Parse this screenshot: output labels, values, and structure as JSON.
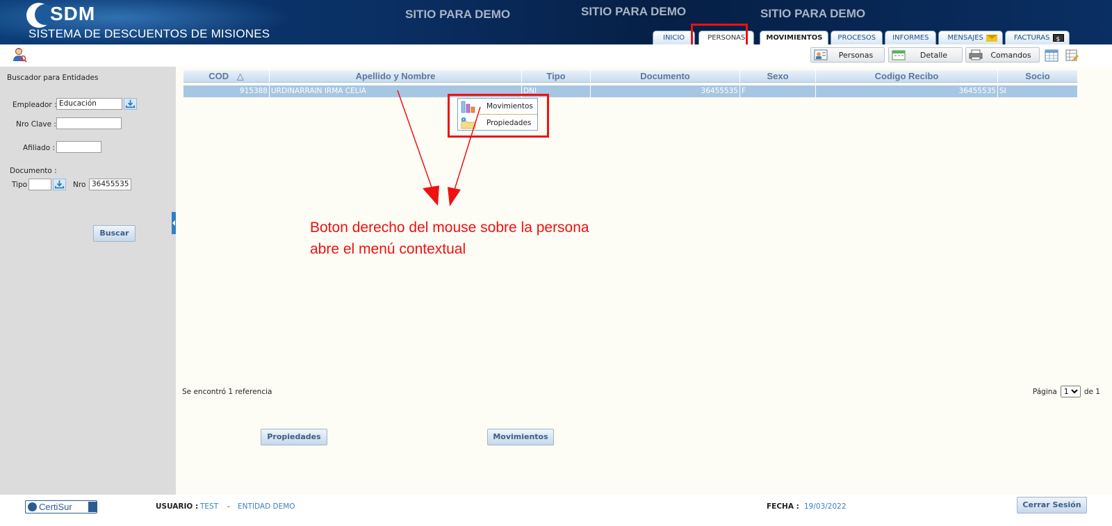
{
  "header": {
    "logo_text": "SDM",
    "subtitle": "SISTEMA DE DESCUENTOS DE  MISIONES",
    "demo_labels": [
      "SITIO PARA DEMO",
      "SITIO PARA DEMO",
      "SITIO PARA DEMO"
    ],
    "tabs": [
      "INICIO",
      "PERSONAS",
      "MOVIMIENTOS",
      "PROCESOS",
      "INFORMES",
      "MENSAJES",
      "FACTURAS"
    ],
    "active_tab": "PERSONAS"
  },
  "toolbar": {
    "personas_label": "Personas",
    "detalle_label": "Detalle",
    "comandos_label": "Comandos"
  },
  "sidebar": {
    "title": "Buscador para Entidades",
    "empleador_label": "Empleador :",
    "empleador_value": "Educación",
    "nro_clave_label": "Nro Clave :",
    "nro_clave_value": "",
    "afiliado_label": "Afiliado :",
    "afiliado_value": "",
    "documento_label": "Documento :",
    "tipo_label": "Tipo",
    "tipo_value": "",
    "nro_label": "Nro",
    "nro_value": "36455535",
    "search_button": "Buscar"
  },
  "grid": {
    "columns": [
      "COD",
      "Apellido y Nombre",
      "Tipo",
      "Documento",
      "Sexo",
      "Codigo Recibo",
      "Socio"
    ],
    "sort_indicator": "△",
    "rows": [
      {
        "cod": "915388",
        "nombre": "URDINARRAIN IRMA CELIA",
        "tipo": "DNI",
        "documento": "36455535",
        "sexo": "F",
        "codigo_recibo": "36455535",
        "socio": "SI"
      }
    ]
  },
  "context_menu": {
    "items": [
      "Movimientos",
      "Propiedades"
    ]
  },
  "annotation": {
    "line1": "Boton derecho del mouse sobre la persona",
    "line2": "abre el menú contextual"
  },
  "status": {
    "found_text": "Se encontró 1 referencia",
    "page_label": "Página",
    "page_value": "1",
    "of_label": "de 1"
  },
  "actions": {
    "propiedades_label": "Propiedades",
    "movimientos_label": "Movimientos"
  },
  "footer": {
    "cert_text": "CertiSur",
    "usuario_label": "USUARIO :",
    "usuario_value": "TEST",
    "separator": "-",
    "entidad_value": "ENTIDAD DEMO",
    "fecha_label": "FECHA :",
    "fecha_value": "19/03/2022",
    "logout_label": "Cerrar Sesión"
  },
  "colors": {
    "header_bg": "#0a2f63",
    "highlight_red": "#ee1111",
    "row_selected": "#a7c6e4",
    "link_blue": "#3a7fbf"
  }
}
